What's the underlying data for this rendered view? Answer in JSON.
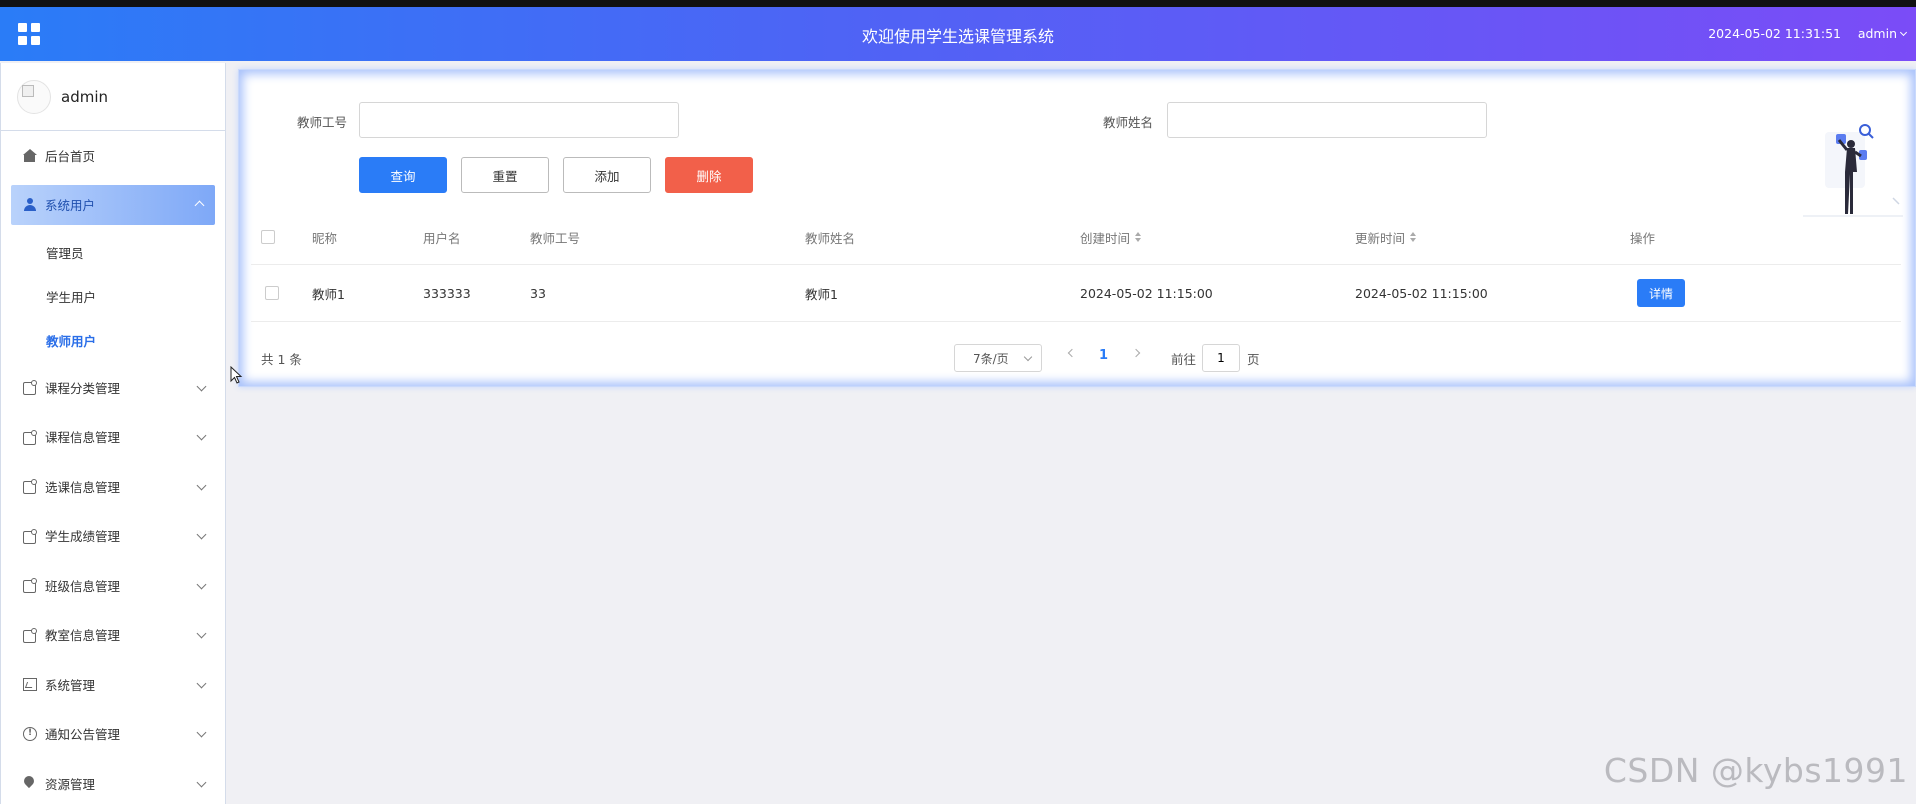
{
  "header": {
    "title": "欢迎使用学生选课管理系统",
    "datetime": "2024-05-02 11:31:51",
    "user": "admin"
  },
  "sidebar": {
    "profile_name": "admin",
    "items": [
      {
        "label": "后台首页",
        "icon": "home-icon"
      },
      {
        "label": "系统用户",
        "icon": "user-icon",
        "expanded": true,
        "children": [
          {
            "label": "管理员"
          },
          {
            "label": "学生用户"
          },
          {
            "label": "教师用户",
            "current": true
          }
        ]
      },
      {
        "label": "课程分类管理",
        "icon": "box-icon"
      },
      {
        "label": "课程信息管理",
        "icon": "box-icon"
      },
      {
        "label": "选课信息管理",
        "icon": "box-icon"
      },
      {
        "label": "学生成绩管理",
        "icon": "box-icon"
      },
      {
        "label": "班级信息管理",
        "icon": "box-icon"
      },
      {
        "label": "教室信息管理",
        "icon": "box-icon"
      },
      {
        "label": "系统管理",
        "icon": "image-icon"
      },
      {
        "label": "通知公告管理",
        "icon": "info-icon"
      },
      {
        "label": "资源管理",
        "icon": "pin-icon"
      }
    ]
  },
  "search": {
    "teacher_no_label": "教师工号",
    "teacher_no_value": "",
    "teacher_name_label": "教师姓名",
    "teacher_name_value": ""
  },
  "toolbar": {
    "query_label": "查询",
    "reset_label": "重置",
    "add_label": "添加",
    "delete_label": "删除"
  },
  "table": {
    "headers": {
      "nickname": "昵称",
      "username": "用户名",
      "teacher_no": "教师工号",
      "teacher_name": "教师姓名",
      "created": "创建时间",
      "updated": "更新时间",
      "actions": "操作"
    },
    "rows": [
      {
        "nickname": "教师1",
        "username": "333333",
        "teacher_no": "33",
        "teacher_name": "教师1",
        "created": "2024-05-02 11:15:00",
        "updated": "2024-05-02 11:15:00",
        "action_label": "详情"
      }
    ]
  },
  "pagination": {
    "total_text": "共 1 条",
    "page_size": "7条/页",
    "current_page": "1",
    "goto_prefix": "前往",
    "goto_value": "1",
    "goto_suffix": "页"
  },
  "watermark": "CSDN @kybs1991",
  "colors": {
    "primary": "#2a7cf7",
    "danger": "#f2604a",
    "header_start": "#2a7cf7",
    "header_end": "#7b4cf7"
  }
}
